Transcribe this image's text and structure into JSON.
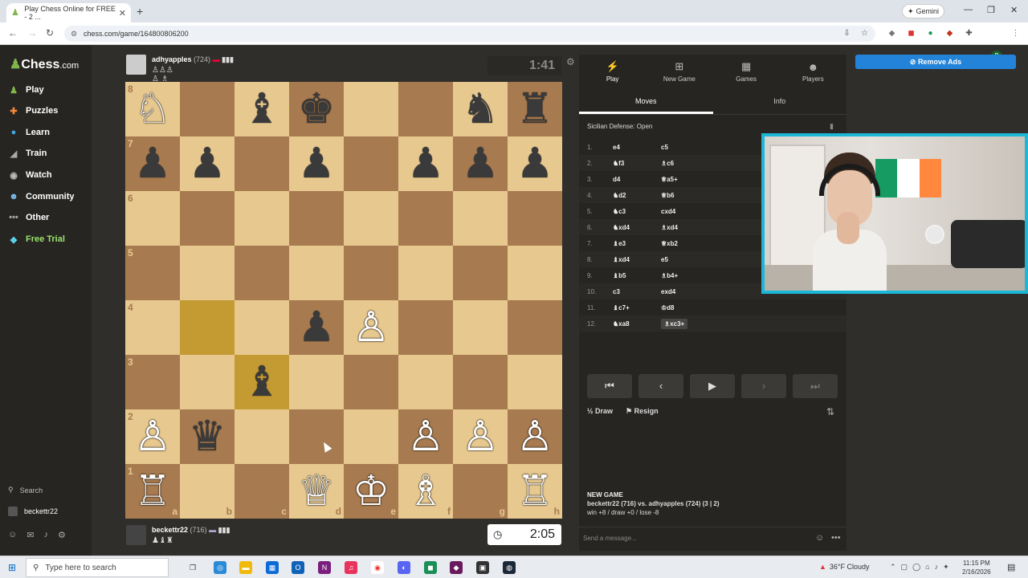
{
  "browser": {
    "tab_title": "Play Chess Online for FREE - 2 ...",
    "url": "chess.com/game/164800806200",
    "gemini_label": "Gemini",
    "profile_initial": "B"
  },
  "sidebar": {
    "logo": "Chess",
    "logo_suffix": ".com",
    "items": [
      {
        "label": "Play",
        "icon": "play-pawn-icon"
      },
      {
        "label": "Puzzles",
        "icon": "puzzle-icon"
      },
      {
        "label": "Learn",
        "icon": "learn-icon"
      },
      {
        "label": "Train",
        "icon": "train-icon"
      },
      {
        "label": "Watch",
        "icon": "watch-icon"
      },
      {
        "label": "Community",
        "icon": "community-icon"
      },
      {
        "label": "Other",
        "icon": "more-dots-icon"
      },
      {
        "label": "Free Trial",
        "icon": "diamond-icon"
      }
    ],
    "search_label": "Search",
    "username": "beckettr22"
  },
  "top_player": {
    "name": "adhyapples",
    "rating": "(724)",
    "clock": "1:41"
  },
  "bottom_player": {
    "name": "beckettr22",
    "rating": "(716)",
    "clock": "2:05"
  },
  "board": {
    "ranks": [
      "8",
      "7",
      "6",
      "5",
      "4",
      "3",
      "2",
      "1"
    ],
    "files": [
      "a",
      "b",
      "c",
      "d",
      "e",
      "f",
      "g",
      "h"
    ],
    "position": [
      [
        "wN",
        "",
        "bB",
        "bK",
        "",
        "",
        "bN",
        "bR"
      ],
      [
        "bP",
        "bP",
        "",
        "bP",
        "",
        "bP",
        "bP",
        "bP"
      ],
      [
        "",
        "",
        "",
        "",
        "",
        "",
        "",
        ""
      ],
      [
        "",
        "",
        "",
        "",
        "",
        "",
        "",
        ""
      ],
      [
        "",
        "",
        "",
        "bP",
        "wP",
        "",
        "",
        ""
      ],
      [
        "",
        "",
        "bB",
        "",
        "",
        "",
        "",
        ""
      ],
      [
        "wP",
        "bQ",
        "",
        "",
        "",
        "wP",
        "wP",
        "wP"
      ],
      [
        "wR",
        "",
        "",
        "wQ",
        "wK",
        "wB",
        "",
        "wR"
      ]
    ],
    "highlighted": [
      "b4",
      "c3"
    ]
  },
  "panel": {
    "tabs": [
      {
        "label": "Play",
        "icon": "lightning-icon"
      },
      {
        "label": "New Game",
        "icon": "plus-square-icon"
      },
      {
        "label": "Games",
        "icon": "games-grid-icon"
      },
      {
        "label": "Players",
        "icon": "players-icon"
      }
    ],
    "subtabs": [
      "Moves",
      "Info"
    ],
    "opening": "Sicilian Defense: Open",
    "moves": [
      {
        "n": "1.",
        "w": "e4",
        "b": "c5"
      },
      {
        "n": "2.",
        "w": "♞f3",
        "b": "♗c6"
      },
      {
        "n": "3.",
        "w": "d4",
        "b": "♕a5+"
      },
      {
        "n": "4.",
        "w": "♞d2",
        "b": "♕b6"
      },
      {
        "n": "5.",
        "w": "♞c3",
        "b": "cxd4"
      },
      {
        "n": "6.",
        "w": "♞xd4",
        "b": "♗xd4"
      },
      {
        "n": "7.",
        "w": "♝e3",
        "b": "♕xb2"
      },
      {
        "n": "8.",
        "w": "♝xd4",
        "b": "e5"
      },
      {
        "n": "9.",
        "w": "♝b5",
        "b": "♗b4+"
      },
      {
        "n": "10.",
        "w": "c3",
        "b": "exd4"
      },
      {
        "n": "11.",
        "w": "♝c7+",
        "b": "♔d8"
      },
      {
        "n": "12.",
        "w": "♞xa8",
        "b": "♗xc3+"
      }
    ],
    "draw_label": "Draw",
    "resign_label": "Resign",
    "chat_header": "NEW GAME",
    "chat_line1": "beckettr22 (716) vs. adhyapples (724) (3 | 2)",
    "chat_line2": "win +8 / draw +0 / lose -8",
    "message_placeholder": "Send a message..."
  },
  "remove_ads": "Remove Ads",
  "taskbar": {
    "search_placeholder": "Type here to search",
    "weather": "36°F  Cloudy",
    "time": "11:15 PM",
    "date": "2/16/2026"
  },
  "colors": {
    "accent_green": "#81b64c",
    "board_light": "#e7c88f",
    "board_dark": "#a77a4f",
    "remove_ads": "#2283d9",
    "webcam_border": "#1cb6d6"
  }
}
